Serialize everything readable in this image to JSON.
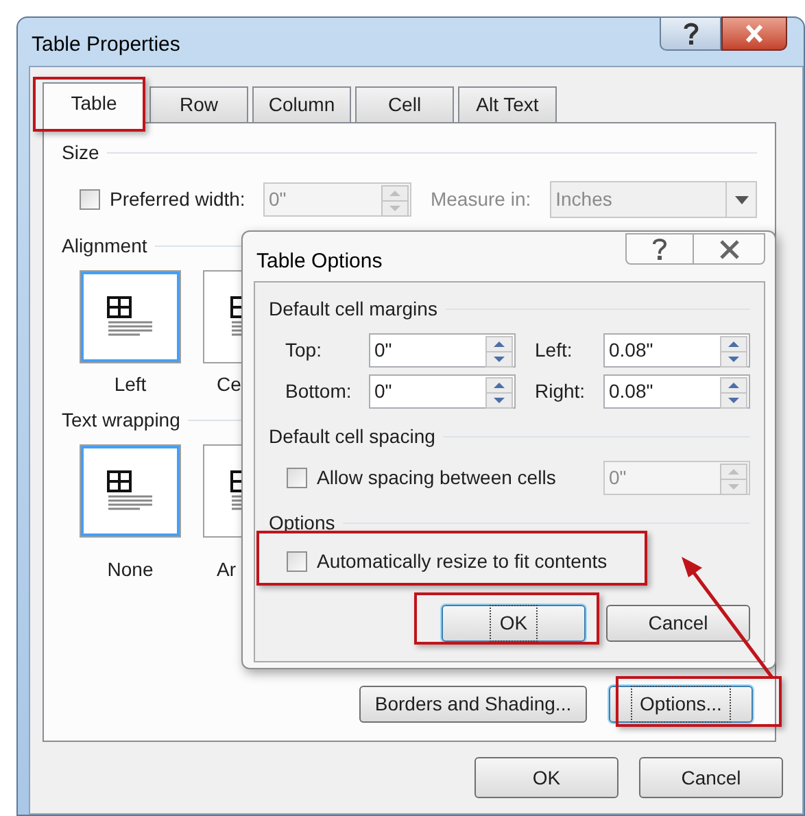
{
  "window": {
    "title": "Table Properties"
  },
  "tabs": [
    {
      "label": "Table",
      "selected": true
    },
    {
      "label": "Row",
      "selected": false
    },
    {
      "label": "Column",
      "selected": false
    },
    {
      "label": "Cell",
      "selected": false
    },
    {
      "label": "Alt Text",
      "selected": false
    }
  ],
  "size": {
    "heading": "Size",
    "preferred_width": {
      "label": "Preferred width:",
      "checked": false,
      "value": "0\"",
      "disabled": true
    },
    "measure_in": {
      "label": "Measure in:",
      "value": "Inches",
      "disabled": true
    }
  },
  "alignment": {
    "heading": "Alignment",
    "options": [
      {
        "label": "Left",
        "selected": true
      },
      {
        "label": "Ce",
        "selected": false
      }
    ]
  },
  "text_wrapping": {
    "heading": "Text wrapping",
    "options": [
      {
        "label": "None",
        "selected": true
      },
      {
        "label": "Ar",
        "selected": false
      }
    ]
  },
  "panel_buttons": [
    {
      "label": "Borders and Shading...",
      "focused": false
    },
    {
      "label": "Options...",
      "focused": true
    }
  ],
  "footer_buttons": [
    {
      "label": "OK",
      "focused": false
    },
    {
      "label": "Cancel",
      "focused": false
    }
  ],
  "table_options": {
    "title": "Table Options",
    "margins": {
      "heading": "Default cell margins",
      "fields": [
        {
          "label": "Top:",
          "value": "0\""
        },
        {
          "label": "Left:",
          "value": "0.08\""
        },
        {
          "label": "Bottom:",
          "value": "0\""
        },
        {
          "label": "Right:",
          "value": "0.08\""
        }
      ]
    },
    "spacing": {
      "heading": "Default cell spacing",
      "checkbox": {
        "label": "Allow spacing between cells",
        "checked": false
      },
      "field": {
        "value": "0\"",
        "disabled": true
      }
    },
    "options": {
      "heading": "Options",
      "checkbox": {
        "label": "Automatically resize to fit contents",
        "checked": false
      }
    },
    "buttons": [
      {
        "label": "OK",
        "focused": true
      },
      {
        "label": "Cancel",
        "focused": false
      }
    ]
  }
}
